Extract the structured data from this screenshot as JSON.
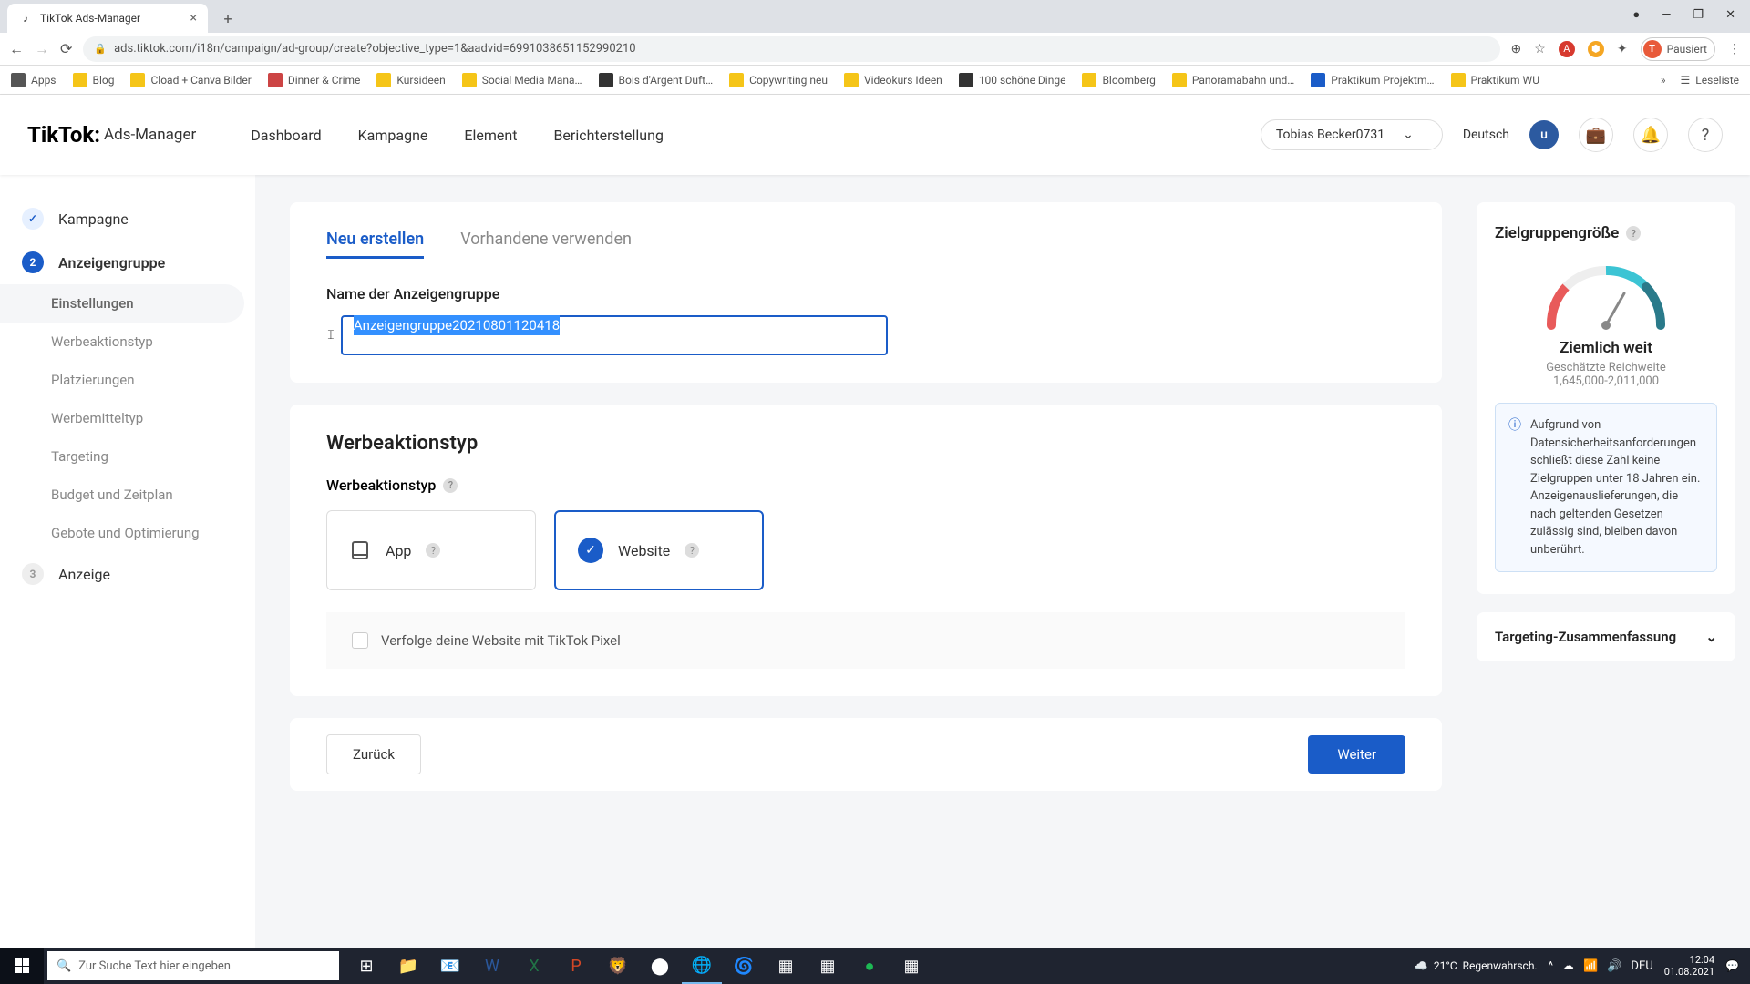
{
  "browser": {
    "tab_title": "TikTok Ads-Manager",
    "url": "ads.tiktok.com/i18n/campaign/ad-group/create?objective_type=1&aadvid=6991038651152990210",
    "profile_status": "Pausiert",
    "profile_initial": "T",
    "bookmarks": [
      "Apps",
      "Blog",
      "Cload + Canva Bilder",
      "Dinner & Crime",
      "Kursideen",
      "Social Media Mana…",
      "Bois d'Argent Duft…",
      "Copywriting neu",
      "Videokurs Ideen",
      "100 schöne Dinge",
      "Bloomberg",
      "Panoramabahn und…",
      "Praktikum Projektm…",
      "Praktikum WU"
    ],
    "reading_list": "Leseliste"
  },
  "header": {
    "logo_main": "TikTok:",
    "logo_sub": "Ads-Manager",
    "nav": [
      "Dashboard",
      "Kampagne",
      "Element",
      "Berichterstellung"
    ],
    "account": "Tobias Becker0731",
    "language": "Deutsch",
    "avatar_initial": "u"
  },
  "sidebar": {
    "step1": "Kampagne",
    "step2": "Anzeigengruppe",
    "step2_num": "2",
    "substeps": [
      "Einstellungen",
      "Werbeaktionstyp",
      "Platzierungen",
      "Werbemitteltyp",
      "Targeting",
      "Budget und Zeitplan",
      "Gebote und Optimierung"
    ],
    "step3": "Anzeige",
    "step3_num": "3"
  },
  "content": {
    "tab_new": "Neu erstellen",
    "tab_existing": "Vorhandene verwenden",
    "name_label": "Name der Anzeigengruppe",
    "name_value": "Anzeigengruppe20210801120418",
    "promo_section": "Werbeaktionstyp",
    "promo_label": "Werbeaktionstyp",
    "option_app": "App",
    "option_website": "Website",
    "pixel_checkbox": "Verfolge deine Website mit TikTok Pixel",
    "btn_back": "Zurück",
    "btn_next": "Weiter"
  },
  "right": {
    "audience_title": "Zielgruppengröße",
    "gauge_label": "Ziemlich weit",
    "reach_label": "Geschätzte Reichweite",
    "reach_value": "1,645,000-2,011,000",
    "info_text": "Aufgrund von Datensicherheitsanforderungen schließt diese Zahl keine Zielgruppen unter 18 Jahren ein. Anzeigenauslieferungen, die nach geltenden Gesetzen zulässig sind, bleiben davon unberührt.",
    "targeting_summary": "Targeting-Zusammenfassung"
  },
  "taskbar": {
    "search_placeholder": "Zur Suche Text hier eingeben",
    "weather_temp": "21°C",
    "weather_text": "Regenwahrsch.",
    "lang": "DEU",
    "time": "12:04",
    "date": "01.08.2021"
  }
}
